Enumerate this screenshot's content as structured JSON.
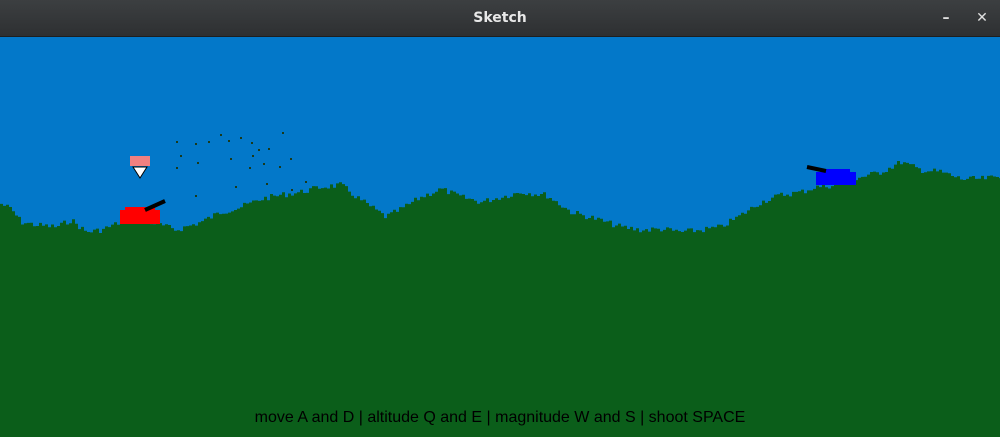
{
  "window": {
    "title": "Sketch",
    "minimize_glyph": "–",
    "close_glyph": "✕"
  },
  "scene": {
    "sky_color": "#0378c9",
    "ground_color": "#0b5e1a",
    "player_tank_color": "#ff0000",
    "enemy_tank_color": "#0000ff",
    "marker_color": "#f08080"
  },
  "instructions": "move A and D | altitude Q and E | magnitude W and S | shoot SPACE"
}
